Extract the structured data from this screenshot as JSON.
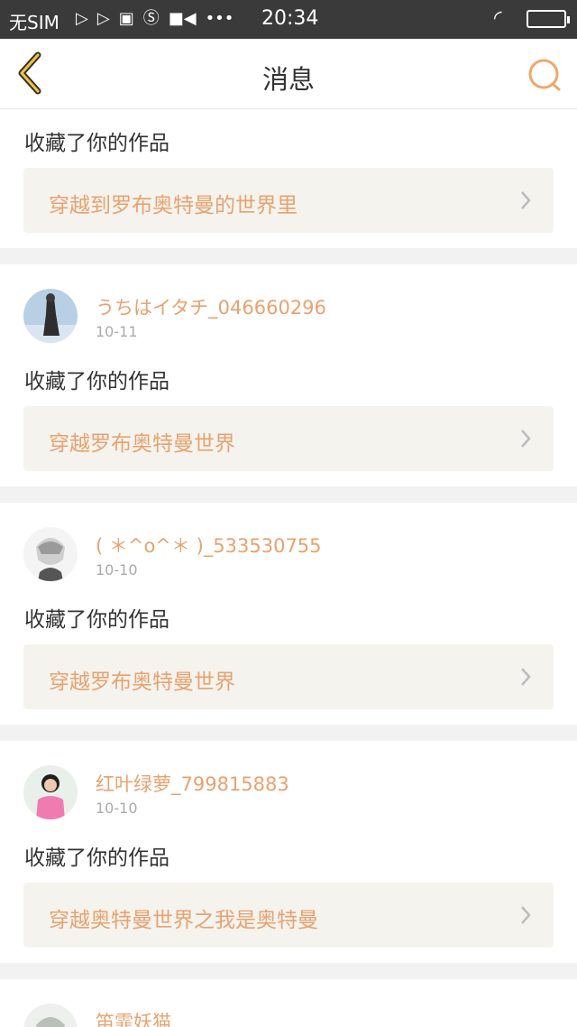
{
  "status_bar": {
    "carrier": "无SIM",
    "time": "20:34",
    "icons": [
      "play-icon",
      "play-icon",
      "bag-icon",
      "s-icon",
      "video-icon",
      "more-dots-icon",
      "wifi-icon",
      "battery-icon"
    ]
  },
  "nav": {
    "title": "消息",
    "back_icon": "chevron-left-icon",
    "search_icon": "search-icon",
    "accent_color": "#f0a86a"
  },
  "feed": {
    "items": [
      {
        "username": "",
        "date": "",
        "action": "收藏了你的作品",
        "work_title": "穿越到罗布奥特曼的世界里"
      },
      {
        "username": "うちはイタチ_046660296",
        "date": "10-11",
        "action": "收藏了你的作品",
        "work_title": "穿越罗布奥特曼世界"
      },
      {
        "username": "( ＊^o^＊ )_533530755",
        "date": "10-10",
        "action": "收藏了你的作品",
        "work_title": "穿越罗布奥特曼世界"
      },
      {
        "username": "红叶绿萝_799815883",
        "date": "10-10",
        "action": "收藏了你的作品",
        "work_title": "穿越奥特曼世界之我是奥特曼"
      },
      {
        "username": "笛霏妖猫",
        "date": "",
        "action": "",
        "work_title": ""
      }
    ]
  },
  "colors": {
    "username": "#e8a26f",
    "work_bg": "#f4f3ee",
    "status_bar_bg": "#3a3a3a"
  }
}
